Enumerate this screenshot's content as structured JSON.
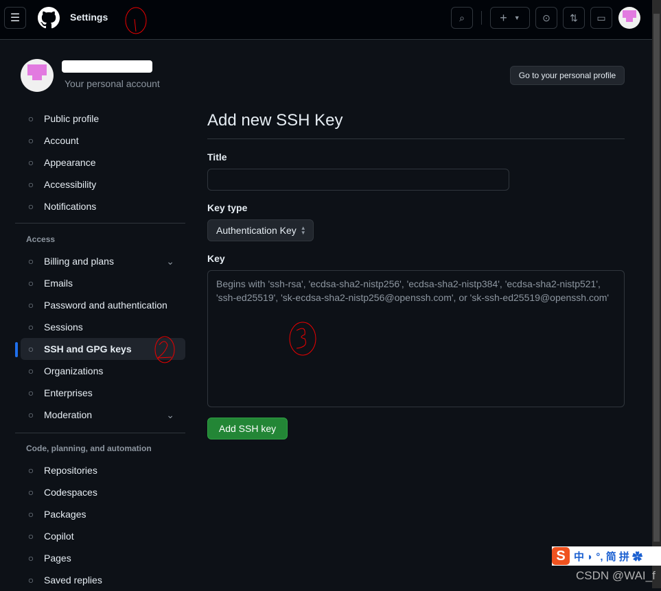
{
  "header": {
    "title": "Settings",
    "avatar_color": "#e27ae0"
  },
  "account": {
    "subtitle": "Your personal account",
    "profile_button": "Go to your personal profile"
  },
  "sidebar": {
    "group1": [
      {
        "label": "Public profile",
        "icon": "person-icon"
      },
      {
        "label": "Account",
        "icon": "gear-icon"
      },
      {
        "label": "Appearance",
        "icon": "paintbrush-icon"
      },
      {
        "label": "Accessibility",
        "icon": "accessibility-icon"
      },
      {
        "label": "Notifications",
        "icon": "bell-icon"
      }
    ],
    "access_heading": "Access",
    "group2": [
      {
        "label": "Billing and plans",
        "icon": "credit-card-icon",
        "chevron": true
      },
      {
        "label": "Emails",
        "icon": "mail-icon"
      },
      {
        "label": "Password and authentication",
        "icon": "shield-icon"
      },
      {
        "label": "Sessions",
        "icon": "broadcast-icon"
      },
      {
        "label": "SSH and GPG keys",
        "icon": "key-icon",
        "active": true
      },
      {
        "label": "Organizations",
        "icon": "organization-icon"
      },
      {
        "label": "Enterprises",
        "icon": "globe-icon"
      },
      {
        "label": "Moderation",
        "icon": "report-icon",
        "chevron": true
      }
    ],
    "code_heading": "Code, planning, and automation",
    "group3": [
      {
        "label": "Repositories",
        "icon": "repo-icon"
      },
      {
        "label": "Codespaces",
        "icon": "codespaces-icon"
      },
      {
        "label": "Packages",
        "icon": "package-icon"
      },
      {
        "label": "Copilot",
        "icon": "copilot-icon"
      },
      {
        "label": "Pages",
        "icon": "browser-icon"
      },
      {
        "label": "Saved replies",
        "icon": "reply-icon"
      }
    ]
  },
  "main": {
    "title": "Add new SSH Key",
    "title_label": "Title",
    "title_value": "",
    "key_type_label": "Key type",
    "key_type_value": "Authentication Key",
    "key_label": "Key",
    "key_placeholder": "Begins with 'ssh-rsa', 'ecdsa-sha2-nistp256', 'ecdsa-sha2-nistp384', 'ecdsa-sha2-nistp521', 'ssh-ed25519', 'sk-ecdsa-sha2-nistp256@openssh.com', or 'sk-ssh-ed25519@openssh.com'",
    "submit": "Add SSH key",
    "accent": "#238636"
  },
  "ime": {
    "chars": "中 ◗ °, 简 拼 ✿"
  },
  "watermark": "CSDN @WAI_f"
}
